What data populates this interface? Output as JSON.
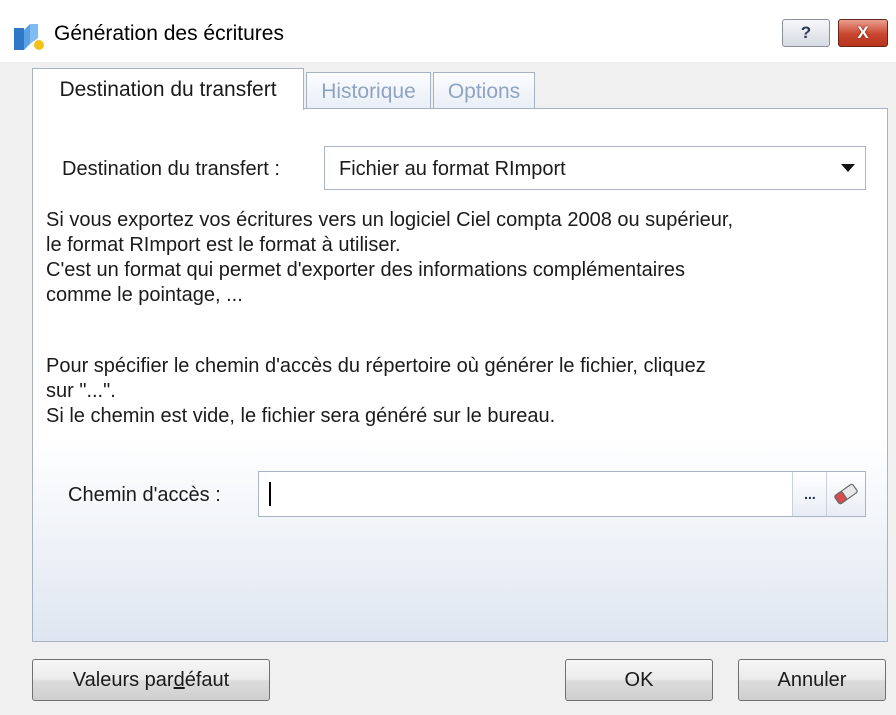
{
  "window": {
    "title": "Génération des écritures",
    "help_label": "?",
    "close_label": "X"
  },
  "tabs": [
    {
      "label": "Destination du transfert",
      "active": true
    },
    {
      "label": "Historique",
      "active": false
    },
    {
      "label": "Options",
      "active": false
    }
  ],
  "destination": {
    "label": "Destination du transfert :",
    "selected": "Fichier au format RImport"
  },
  "info": {
    "para1": [
      "Si vous exportez vos écritures vers un logiciel Ciel compta 2008 ou supérieur,",
      "le format RImport est le format à utiliser.",
      "C'est un format qui permet d'exporter des informations complémentaires",
      "comme le pointage, ..."
    ],
    "para2": [
      "Pour spécifier le chemin d'accès du répertoire où générer le fichier, cliquez",
      "sur \"...\".",
      "Si le chemin est vide, le fichier sera généré sur le bureau."
    ]
  },
  "path": {
    "label": "Chemin d'accès :",
    "value": "",
    "browse_label": "..."
  },
  "buttons": {
    "default_prefix": "Valeurs par ",
    "default_mnemonic": "d",
    "default_suffix": "éfaut",
    "ok": "OK",
    "cancel": "Annuler"
  },
  "colors": {
    "panel_gradient_end": "#dfe6f1",
    "inactive_tab_text": "#8fa4c0",
    "close_button": "#c9452d"
  },
  "icons": {
    "app": "ciel-logo-icon",
    "browse": "ellipsis-icon",
    "erase": "eraser-icon"
  }
}
